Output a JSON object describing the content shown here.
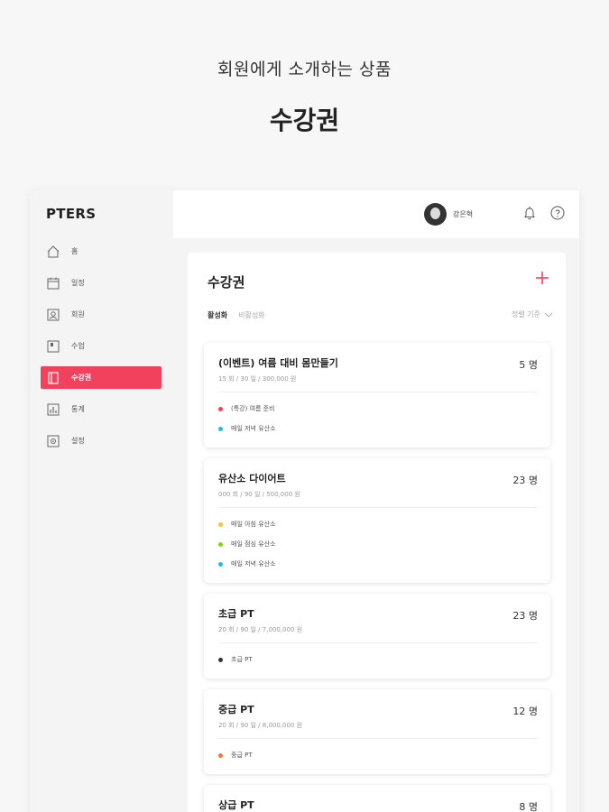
{
  "promo": {
    "subtitle": "회원에게 소개하는 상품",
    "title": "수강권"
  },
  "app": {
    "logo": "PTERS"
  },
  "sidebar": {
    "items": [
      {
        "label": "홈",
        "icon": "home-icon"
      },
      {
        "label": "일정",
        "icon": "calendar-icon"
      },
      {
        "label": "회원",
        "icon": "member-icon"
      },
      {
        "label": "수업",
        "icon": "lesson-icon"
      },
      {
        "label": "수강권",
        "icon": "ticket-icon",
        "active": true
      },
      {
        "label": "통계",
        "icon": "chart-icon"
      },
      {
        "label": "설정",
        "icon": "settings-icon"
      }
    ]
  },
  "topbar": {
    "username": "강은혁"
  },
  "panel": {
    "title": "수강권",
    "tabs": [
      "활성화",
      "비활성화"
    ],
    "sort_label": "정렬 기준"
  },
  "colors": {
    "accent": "#f1415d"
  },
  "tickets": [
    {
      "name": "(이벤트) 여름 대비 몸만들기",
      "count": "5 명",
      "meta": "15 회 / 30 일 / 300,000 원",
      "lessons": [
        {
          "label": "(특강) 여름 준비",
          "color": "#f1415d"
        },
        {
          "label": "매일 저녁 유산소",
          "color": "#26bcd7"
        }
      ]
    },
    {
      "name": "유산소 다이어트",
      "count": "23 명",
      "meta": "000 회 / 90 일 / 500,000 원",
      "lessons": [
        {
          "label": "매일 아침 유산소",
          "color": "#f5c33b"
        },
        {
          "label": "매일 점심 유산소",
          "color": "#7ed321"
        },
        {
          "label": "매일 저녁 유산소",
          "color": "#26bcd7"
        }
      ]
    },
    {
      "name": "초급 PT",
      "count": "23 명",
      "meta": "20 회 / 90 일 / 7,000,000 원",
      "lessons": [
        {
          "label": "초급 PT",
          "color": "#333333"
        }
      ]
    },
    {
      "name": "중급 PT",
      "count": "12 명",
      "meta": "20 회 / 90 일 / 8,000,000 원",
      "lessons": [
        {
          "label": "중급 PT",
          "color": "#f2773a"
        }
      ]
    },
    {
      "name": "상급 PT",
      "count": "8 명",
      "meta": "",
      "lessons": []
    }
  ]
}
